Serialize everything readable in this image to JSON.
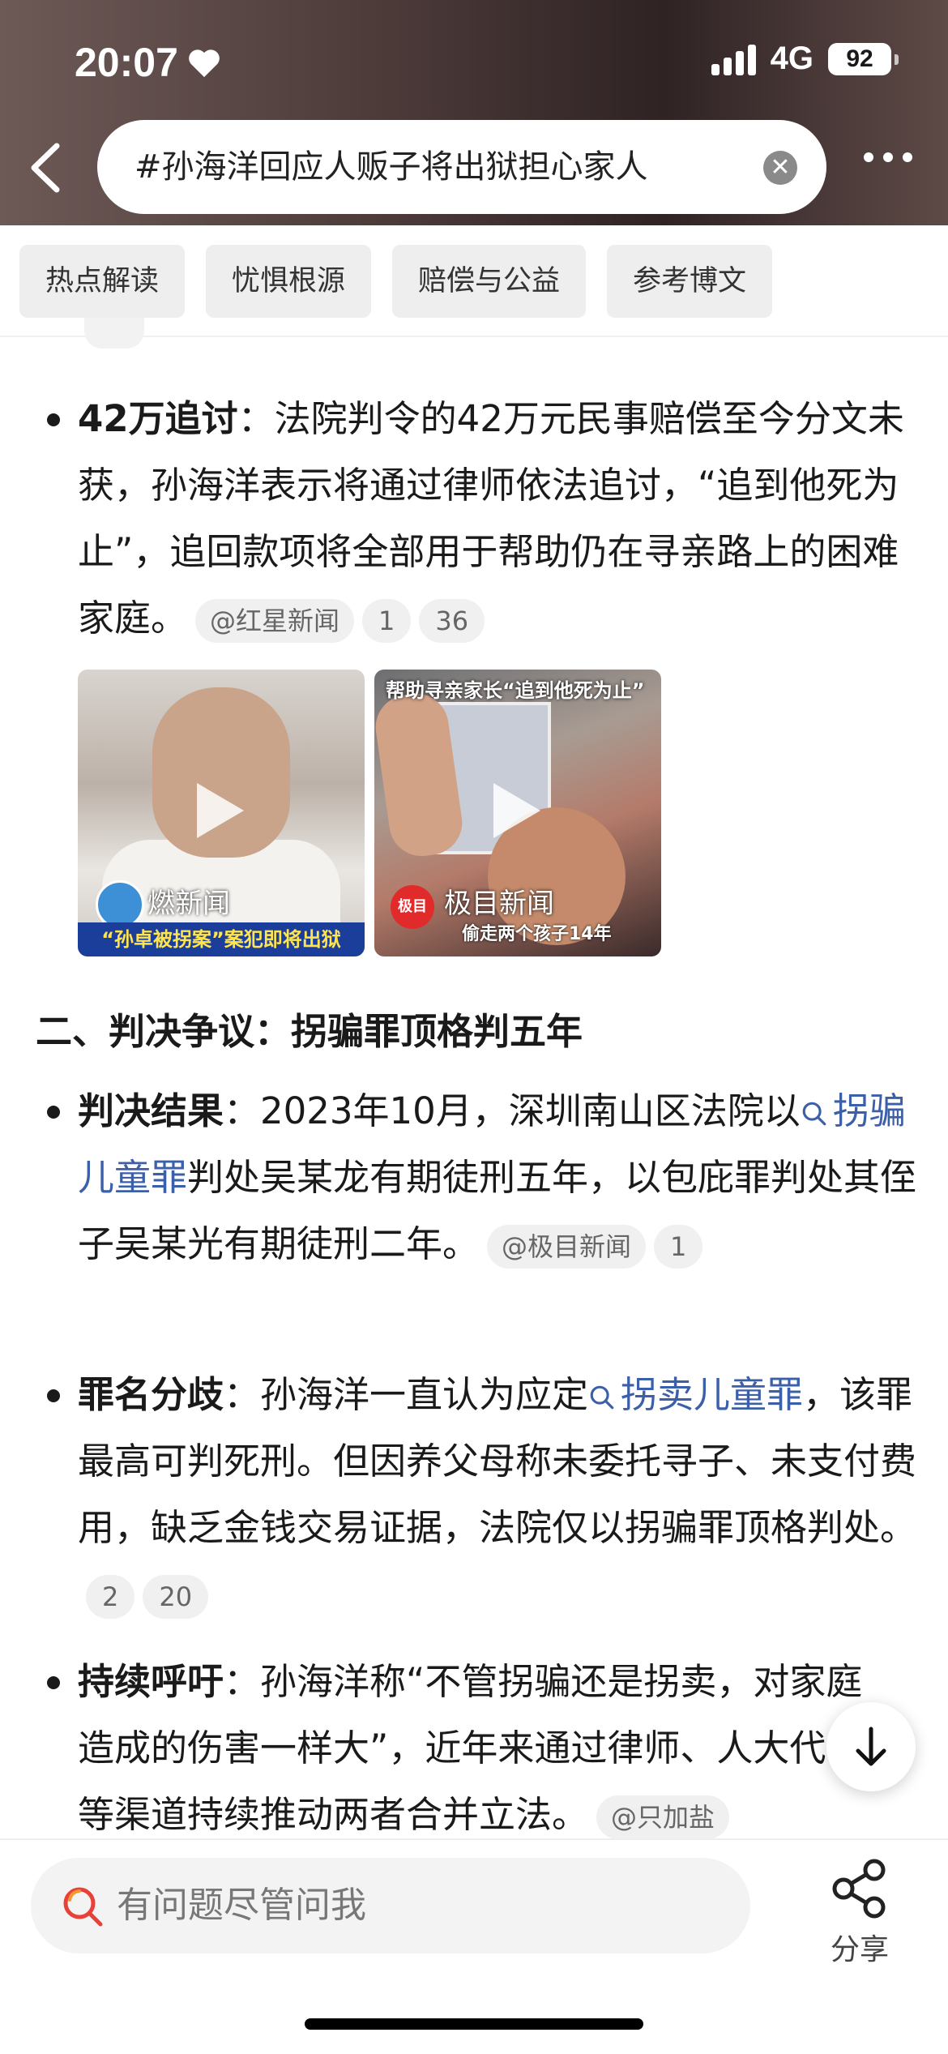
{
  "status_bar": {
    "time": "20:07",
    "network": "4G",
    "battery": "92"
  },
  "search": {
    "query": "#孙海洋回应人贩子将出狱担心家人"
  },
  "tabs": [
    "热点解读",
    "忧惧根源",
    "赔偿与公益",
    "参考博文"
  ],
  "section1": {
    "bullet": {
      "title": "42万追讨",
      "text": "：法院判令的42万元民事赔偿至今分文未获，孙海洋表示将通过律师依法追讨，“追到他死为止”，追回款项将全部用于帮助仍在寻亲路上的困难家庭。",
      "source": "@红星新闻",
      "refs": [
        "1",
        "36"
      ]
    },
    "videos": [
      {
        "logo": "燃新闻",
        "caption": "“孙卓被拐案”案犯即将出狱"
      },
      {
        "logo": "极目新闻",
        "logo_badge": "极目",
        "top": "帮助寻亲家长“追到他死为止”",
        "caption": "偷走两个孩子14年"
      }
    ]
  },
  "section2": {
    "heading": "二、判决争议：拐骗罪顶格判五年",
    "bullets": [
      {
        "title": "判决结果",
        "pre": "：2023年10月，深圳南山区法院以",
        "link": "拐骗儿童罪",
        "post": "判处吴某龙有期徒刑五年，以包庇罪判处其侄子吴某光有期徒刑二年。",
        "source": "@极目新闻",
        "refs": [
          "1"
        ]
      },
      {
        "title": "罪名分歧",
        "pre": "：孙海洋一直认为应定",
        "link": "拐卖儿童罪",
        "post": "，该罪最高可判死刑。但因养父母称未委托寻子、未支付费用，缺乏金钱交易证据，法院仅以拐骗罪顶格判处。",
        "refs": [
          "2",
          "20"
        ]
      },
      {
        "title": "持续呼吁",
        "text": "：孙海洋称“不管拐骗还是拐卖，对家庭造成的伤害一样大”，近年来通过律师、人大代表等渠道持续推动两者合并立法。",
        "source": "@只加盐"
      }
    ]
  },
  "bottom": {
    "ask_placeholder": "有问题尽管问我",
    "share_label": "分享"
  },
  "colors": {
    "link": "#3b5fa8",
    "ask_icon": "#e8413a"
  }
}
